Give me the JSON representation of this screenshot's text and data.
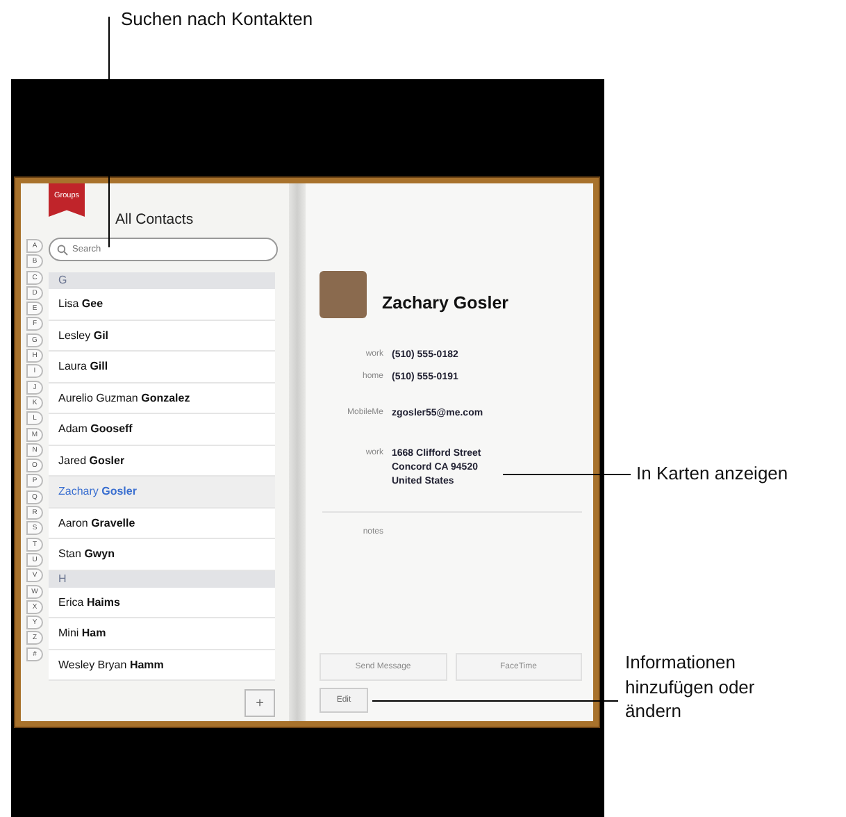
{
  "callouts": [
    {
      "kind": "search",
      "text": "Suchen nach Kontakten"
    },
    {
      "kind": "map",
      "text": "In Karten anzeigen"
    },
    {
      "kind": "edit",
      "text": "Informationen hinzufügen oder ändern"
    }
  ],
  "left_page": {
    "groups_tab": "Groups",
    "title": "All Contacts",
    "search": {
      "placeholder": "Search"
    },
    "index": [
      "A",
      "B",
      "C",
      "D",
      "E",
      "F",
      "G",
      "H",
      "I",
      "J",
      "K",
      "L",
      "M",
      "N",
      "O",
      "P",
      "Q",
      "R",
      "S",
      "T",
      "U",
      "V",
      "W",
      "X",
      "Y",
      "Z",
      "#"
    ],
    "rows": [
      {
        "kind": "header",
        "text": "G"
      },
      {
        "kind": "contact",
        "first": "Lisa",
        "last": "Gee",
        "selected": false
      },
      {
        "kind": "contact",
        "first": "Lesley",
        "last": "Gil",
        "selected": false
      },
      {
        "kind": "contact",
        "first": "Laura",
        "last": "Gill",
        "selected": false
      },
      {
        "kind": "contact",
        "first": "Aurelio Guzman",
        "last": "Gonzalez",
        "selected": false
      },
      {
        "kind": "contact",
        "first": "Adam",
        "last": "Gooseff",
        "selected": false
      },
      {
        "kind": "contact",
        "first": "Jared",
        "last": "Gosler",
        "selected": false
      },
      {
        "kind": "contact",
        "first": "Zachary",
        "last": "Gosler",
        "selected": true
      },
      {
        "kind": "contact",
        "first": "Aaron",
        "last": "Gravelle",
        "selected": false
      },
      {
        "kind": "contact",
        "first": "Stan",
        "last": "Gwyn",
        "selected": false
      },
      {
        "kind": "header",
        "text": "H"
      },
      {
        "kind": "contact",
        "first": "Erica",
        "last": "Haims",
        "selected": false
      },
      {
        "kind": "contact",
        "first": "Mini",
        "last": "Ham",
        "selected": false
      },
      {
        "kind": "contact",
        "first": "Wesley Bryan",
        "last": "Hamm",
        "selected": false
      }
    ],
    "add_button": "+"
  },
  "right_page": {
    "name": "Zachary Gosler",
    "fields": [
      {
        "label": "work",
        "value": "(510) 555-0182"
      },
      {
        "label": "home",
        "value": "(510) 555-0191"
      },
      {
        "label": "MobileMe",
        "value": "zgosler55@me.com"
      },
      {
        "label": "work",
        "value": "1668 Clifford Street\nConcord CA 94520\nUnited States"
      }
    ],
    "notes_label": "notes",
    "buttons": [
      {
        "label": "Send Message",
        "disabled": true
      },
      {
        "label": "FaceTime",
        "disabled": true
      }
    ],
    "edit_button": "Edit"
  }
}
